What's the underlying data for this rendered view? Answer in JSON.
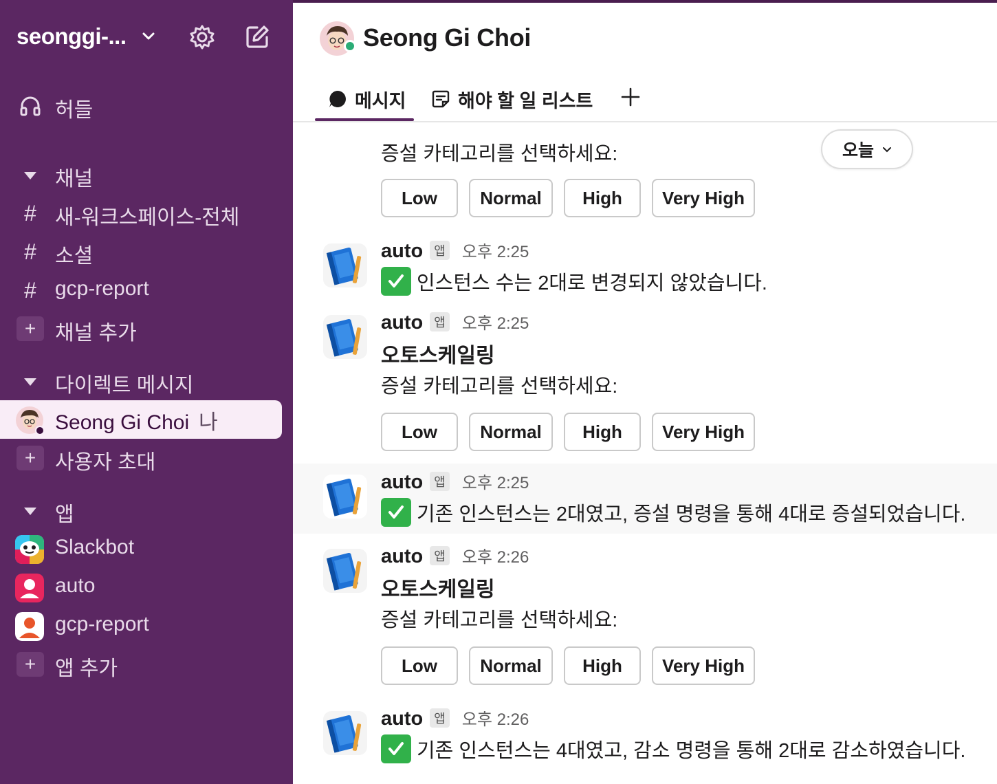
{
  "sidebar": {
    "workspace_name": "seonggi-...",
    "huddles_label": "허들",
    "channels_header": "채널",
    "channels": [
      {
        "prefix": "#",
        "name": "새-워크스페이스-전체"
      },
      {
        "prefix": "#",
        "name": "소셜"
      },
      {
        "prefix": "#",
        "name": "gcp-report"
      }
    ],
    "add_channel_label": "채널 추가",
    "dm_header": "다이렉트 메시지",
    "dm_active_name": "Seong Gi Choi",
    "dm_you_label": "나",
    "invite_label": "사용자 초대",
    "apps_header": "앱",
    "apps": [
      {
        "name": "Slackbot"
      },
      {
        "name": "auto"
      },
      {
        "name": "gcp-report"
      }
    ],
    "add_app_label": "앱 추가"
  },
  "header": {
    "title": "Seong Gi Choi",
    "tabs": [
      {
        "label": "메시지"
      },
      {
        "label": "해야 할 일 리스트"
      }
    ]
  },
  "date_pill": "오늘",
  "category_buttons": [
    "Low",
    "Normal",
    "High",
    "Very High"
  ],
  "messages": [
    {
      "prompt": "증설 카테고리를 선택하세요:"
    },
    {
      "sender": "auto",
      "badge": "앱",
      "time": "오후 2:25",
      "text": "인스턴스 수는 2대로 변경되지 않았습니다."
    },
    {
      "sender": "auto",
      "badge": "앱",
      "time": "오후 2:25",
      "title": "오토스케일링",
      "prompt": "증설 카테고리를 선택하세요:"
    },
    {
      "sender": "auto",
      "badge": "앱",
      "time": "오후 2:25",
      "text": "기존 인스턴스는 2대였고, 증설 명령을 통해 4대로 증설되었습니다."
    },
    {
      "sender": "auto",
      "badge": "앱",
      "time": "오후 2:26",
      "title": "오토스케일링",
      "prompt": "증설 카테고리를 선택하세요:"
    },
    {
      "sender": "auto",
      "badge": "앱",
      "time": "오후 2:26",
      "text": "기존 인스턴스는 4대였고, 감소 명령을 통해 2대로 감소하였습니다."
    }
  ],
  "colors": {
    "sidebar_bg": "#5b2762",
    "active_item_bg": "#f9edf7",
    "presence_green": "#2bac76",
    "check_green": "#31b14a"
  }
}
